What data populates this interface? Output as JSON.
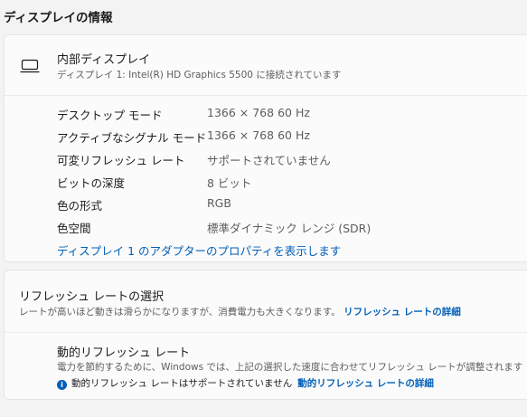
{
  "section_title": "ディスプレイの情報",
  "display": {
    "name": "内部ディスプレイ",
    "subtitle": "ディスプレイ 1: Intel(R) HD Graphics 5500 に接続されています",
    "icon": "monitor-icon",
    "specs": [
      {
        "label": "デスクトップ モード",
        "value": "1366 × 768 60 Hz"
      },
      {
        "label": "アクティブなシグナル モード",
        "value": "1366 × 768 60 Hz"
      },
      {
        "label": "可変リフレッシュ レート",
        "value": "サポートされていません"
      },
      {
        "label": "ビットの深度",
        "value": "8 ビット"
      },
      {
        "label": "色の形式",
        "value": "RGB"
      },
      {
        "label": "色空間",
        "value": "標準ダイナミック レンジ (SDR)"
      }
    ],
    "adapter_link": "ディスプレイ 1 のアダプターのプロパティを表示します"
  },
  "refresh_rate": {
    "title": "リフレッシュ レートの選択",
    "description": "レートが高いほど動きは滑らかになりますが、消費電力も大きくなります。",
    "details_link": "リフレッシュ レートの詳細"
  },
  "dynamic_refresh": {
    "title": "動的リフレッシュ レート",
    "description": "電力を節約するために、Windows では、上記の選択した速度に合わせてリフレッシュ レートが調整されます",
    "note": "動的リフレッシュ レートはサポートされていません",
    "note_link": "動的リフレッシュ レートの詳細",
    "info_icon_glyph": "i"
  },
  "colors": {
    "accent": "#005fb8",
    "background": "#f3f3f3",
    "card": "#fbfbfb"
  }
}
